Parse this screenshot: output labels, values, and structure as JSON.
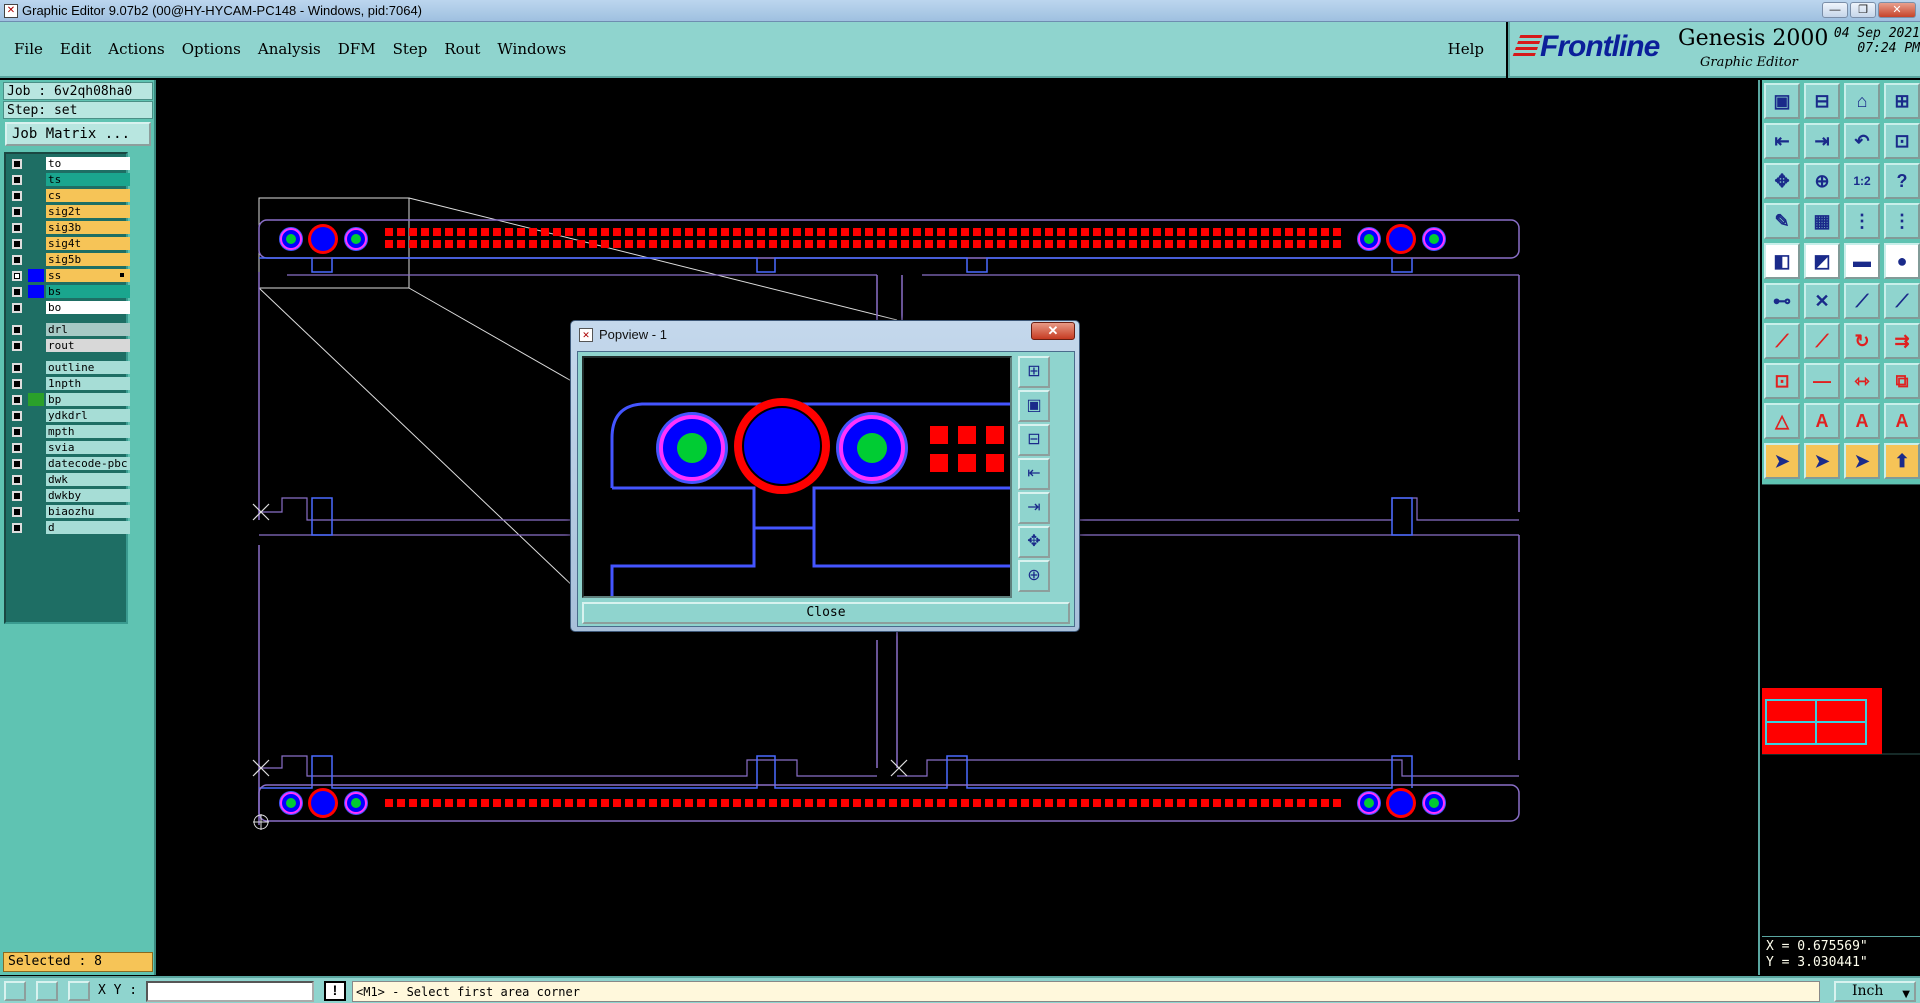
{
  "window": {
    "title": "Graphic Editor 9.07b2 (00@HY-HYCAM-PC148 - Windows, pid:7064)"
  },
  "menu": [
    "File",
    "Edit",
    "Actions",
    "Options",
    "Analysis",
    "DFM",
    "Step",
    "Rout",
    "Windows"
  ],
  "help_label": "Help",
  "brand": {
    "logo": "Frontline",
    "product": "Genesis 2000",
    "subtitle": "Graphic Editor",
    "date": "04 Sep 2021",
    "time": "07:24 PM"
  },
  "job": {
    "job_line": "Job : 6v2qh08ha0",
    "step_line": "Step: set",
    "matrix_button": "Job Matrix ..."
  },
  "layers": [
    {
      "name": "to",
      "color": "#ffffff",
      "checked": false
    },
    {
      "name": "ts",
      "color": "#1aa58e",
      "checked": false
    },
    {
      "name": "cs",
      "color": "#f6c457",
      "checked": false
    },
    {
      "name": "sig2t",
      "color": "#f6c457",
      "checked": false
    },
    {
      "name": "sig3b",
      "color": "#f6c457",
      "checked": false
    },
    {
      "name": "sig4t",
      "color": "#f6c457",
      "checked": false
    },
    {
      "name": "sig5b",
      "color": "#f6c457",
      "checked": false
    },
    {
      "name": "ss",
      "color": "#f6c457",
      "checked": true
    },
    {
      "name": "bs",
      "color": "#1aa58e",
      "checked": false
    },
    {
      "name": "bo",
      "color": "#ffffff",
      "checked": false
    },
    {
      "name": "drl",
      "color": "#a6c9c5",
      "checked": false
    },
    {
      "name": "rout",
      "color": "#d8d8d8",
      "checked": false
    },
    {
      "name": "outline",
      "color": "#a6ddd6",
      "checked": false
    },
    {
      "name": "1npth",
      "color": "#a6ddd6",
      "checked": false
    },
    {
      "name": "bp",
      "color": "#a6ddd6",
      "checked": false
    },
    {
      "name": "ydkdrl",
      "color": "#a6ddd6",
      "checked": false
    },
    {
      "name": "mpth",
      "color": "#a6ddd6",
      "checked": false
    },
    {
      "name": "svia",
      "color": "#a6ddd6",
      "checked": false
    },
    {
      "name": "datecode-pbc",
      "color": "#a6ddd6",
      "checked": false
    },
    {
      "name": "dwk",
      "color": "#a6ddd6",
      "checked": false
    },
    {
      "name": "dwkby",
      "color": "#a6ddd6",
      "checked": false
    },
    {
      "name": "biaozhu",
      "color": "#a6ddd6",
      "checked": false
    },
    {
      "name": "d",
      "color": "#a6ddd6",
      "checked": false
    }
  ],
  "selected_label": "Selected : 8",
  "popview": {
    "title": "Popview - 1",
    "close_label": "Close"
  },
  "status": {
    "xy_label": "X Y :",
    "xy_value": "",
    "prompt": "<M1> - Select first area corner",
    "units": "Inch"
  },
  "coords": {
    "x": "X = 0.675569\"",
    "y": "Y = 3.030441\""
  },
  "colors": {
    "panel": "#8fd4ce",
    "layer_panel": "#5fc3b2",
    "pad_red": "#ff0000",
    "pad_blue": "#0000ff",
    "pad_green": "#00cc33",
    "trace": "#3a3aff",
    "outline": "#8a6fc8"
  },
  "tool_icons": [
    "zoom-home-icon",
    "zoom-redraw-icon",
    "home-icon",
    "split-view-icon",
    "pan-left-icon",
    "pan-right-icon",
    "zoom-back-icon",
    "snap-icon",
    "zoom-fit-icon",
    "center-icon",
    "one-to-two-icon",
    "help-icon",
    "measure-icon",
    "grid-icon",
    "layers-icon",
    "filter-icon",
    "add-feature-icon",
    "drawing-icon",
    "ruler-icon",
    "pad-icon",
    "connect-icon",
    "cross-icon",
    "line-node-icon",
    "move-node-icon",
    "line-red-icon",
    "slash-icon",
    "rotate-icon",
    "mirror-icon",
    "square-node-icon",
    "minus-icon",
    "resize-icon",
    "copy-icon",
    "triangle-icon",
    "arc-a-icon",
    "arc-b-icon",
    "arc-c-icon",
    "pointer-icon",
    "pointer-select-icon",
    "pointer-area-icon",
    "route-icon"
  ],
  "popview_tools": [
    "popview-zoom-icon",
    "popview-home-icon",
    "popview-down-icon",
    "popview-left-icon",
    "popview-right-icon",
    "popview-fit-icon",
    "popview-center-icon"
  ]
}
